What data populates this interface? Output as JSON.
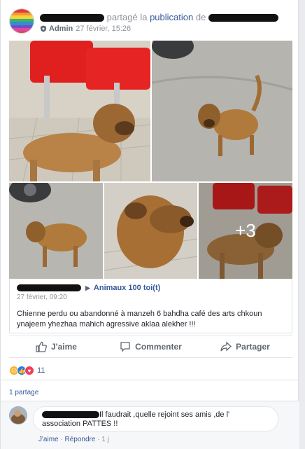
{
  "header": {
    "action_text": "partagé la",
    "publication_link": "publication",
    "de_text": "de",
    "role": "Admin",
    "timestamp": "27 février, 15:26"
  },
  "photos": {
    "more_count": "+3"
  },
  "shared_post": {
    "group_name": "Animaux 100 toi(t)",
    "timestamp": "27 février, 09:20",
    "text": "Chienne perdu ou abandonné à manzeh 6 bahdha café des arts chkoun ynajeem yhezhaa mahich agressive aklaa alekher !!!"
  },
  "actions": {
    "like_label": "J'aime",
    "comment_label": "Commenter",
    "share_label": "Partager"
  },
  "reactions": {
    "count": "11",
    "icons": [
      "sad-icon",
      "like-icon",
      "love-icon"
    ],
    "colors": {
      "sad": "#f7b125",
      "like": "#2078f4",
      "love": "#f33e58"
    }
  },
  "shares": {
    "label": "1 partage"
  },
  "comment": {
    "text": "Il faudrait ,quelle rejoint ses amis ,de l' association PATTES !!",
    "like_label": "J'aime",
    "reply_label": "Répondre",
    "separator": "·",
    "time": "1 j"
  }
}
